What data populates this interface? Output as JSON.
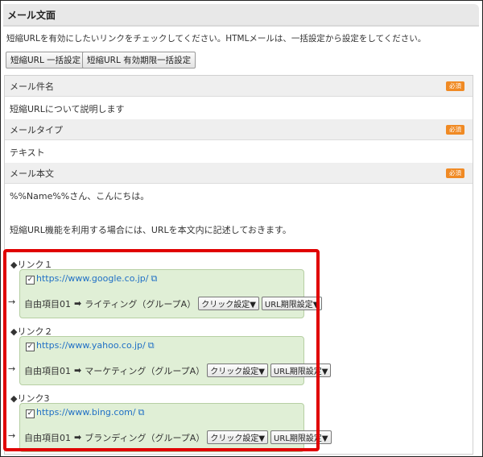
{
  "section": {
    "title": "メール文面"
  },
  "instruction": "短縮URLを有効にしたいリンクをチェックしてください。HTMLメールは、一括設定から設定をしてください。",
  "buttons": {
    "bulk": "短縮URL 一括設定",
    "expiry_bulk": "短縮URL 有効期限一括設定"
  },
  "required_label": "必須",
  "fields": {
    "subject": {
      "label": "メール件名",
      "value": "短縮URLについて説明します"
    },
    "type": {
      "label": "メールタイプ",
      "value": "テキスト"
    },
    "body": {
      "label": "メール本文",
      "line1": "%%Name%%さん、こんにちは。",
      "line2": "短縮URL機能を利用する場合には、URLを本文内に記述しておきます。"
    }
  },
  "links": [
    {
      "title": "◆リンク１",
      "url": "https://www.google.co.jp/",
      "checked": "✓",
      "field": "自由項目01",
      "value": "ライティング（グループA）"
    },
    {
      "title": "◆リンク２",
      "url": "https://www.yahoo.co.jp/",
      "checked": "✓",
      "field": "自由項目01",
      "value": "マーケティング（グループA）"
    },
    {
      "title": "◆リンク3",
      "url": "https://www.bing.com/",
      "checked": "✓",
      "field": "自由項目01",
      "value": "ブランディング（グループA）"
    }
  ],
  "link_buttons": {
    "click": "クリック設定▼",
    "url_expiry": "URL期限設定▼"
  },
  "glyphs": {
    "left_arrow": "→",
    "bold_arrow": "➡",
    "external": "⧉"
  },
  "colors": {
    "required_badge": "#f08a24",
    "highlight_border": "#e00000",
    "link_box_bg": "#e0efd6",
    "url_text": "#1f6fc5"
  }
}
